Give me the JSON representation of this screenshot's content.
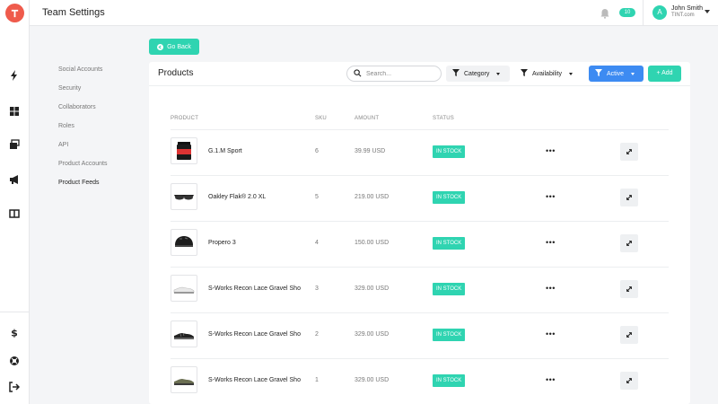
{
  "header": {
    "title": "Team Settings",
    "notification_count": "10",
    "user": {
      "initial": "A",
      "name": "John Smith",
      "org": "TINT.com"
    }
  },
  "rail": {
    "logo_icon": "tint-logo-icon",
    "icons": [
      "lightning-icon",
      "grid-icon",
      "layers-icon",
      "megaphone-icon",
      "columns-icon",
      "dollar-icon",
      "support-icon",
      "logout-icon"
    ]
  },
  "subnav": {
    "items": [
      {
        "label": "Social Accounts"
      },
      {
        "label": "Security"
      },
      {
        "label": "Collaborators"
      },
      {
        "label": "Roles"
      },
      {
        "label": "API"
      },
      {
        "label": "Product Accounts"
      },
      {
        "label": "Product Feeds",
        "active": true
      }
    ]
  },
  "go_back": {
    "label": "Go Back"
  },
  "products": {
    "title": "Products",
    "search_placeholder": "Search...",
    "filters": {
      "category": "Category",
      "availability": "Availability",
      "active": "Active"
    },
    "add_label": "+ Add",
    "columns": {
      "product": "PRODUCT",
      "sku": "SKU",
      "amount": "AMOUNT",
      "status": "STATUS"
    },
    "rows": [
      {
        "name": "G.1.M Sport",
        "sku": "6",
        "amount": "39.99 USD",
        "status": "IN STOCK",
        "thumb": "supplement-tub"
      },
      {
        "name": "Oakley Flak® 2.0 XL",
        "sku": "5",
        "amount": "219.00 USD",
        "status": "IN STOCK",
        "thumb": "sunglasses"
      },
      {
        "name": "Propero 3",
        "sku": "4",
        "amount": "150.00 USD",
        "status": "IN STOCK",
        "thumb": "helmet"
      },
      {
        "name": "S-Works Recon Lace Gravel Sho",
        "sku": "3",
        "amount": "329.00 USD",
        "status": "IN STOCK",
        "thumb": "shoe-white"
      },
      {
        "name": "S-Works Recon Lace Gravel Sho",
        "sku": "2",
        "amount": "329.00 USD",
        "status": "IN STOCK",
        "thumb": "shoe-black"
      },
      {
        "name": "S-Works Recon Lace Gravel Sho",
        "sku": "1",
        "amount": "329.00 USD",
        "status": "IN STOCK",
        "thumb": "shoe-olive"
      }
    ],
    "row_menu": "•••"
  },
  "colors": {
    "accent": "#2fd4b1",
    "primary_blue": "#3d8bf2",
    "logo": "#ef5b4c"
  }
}
